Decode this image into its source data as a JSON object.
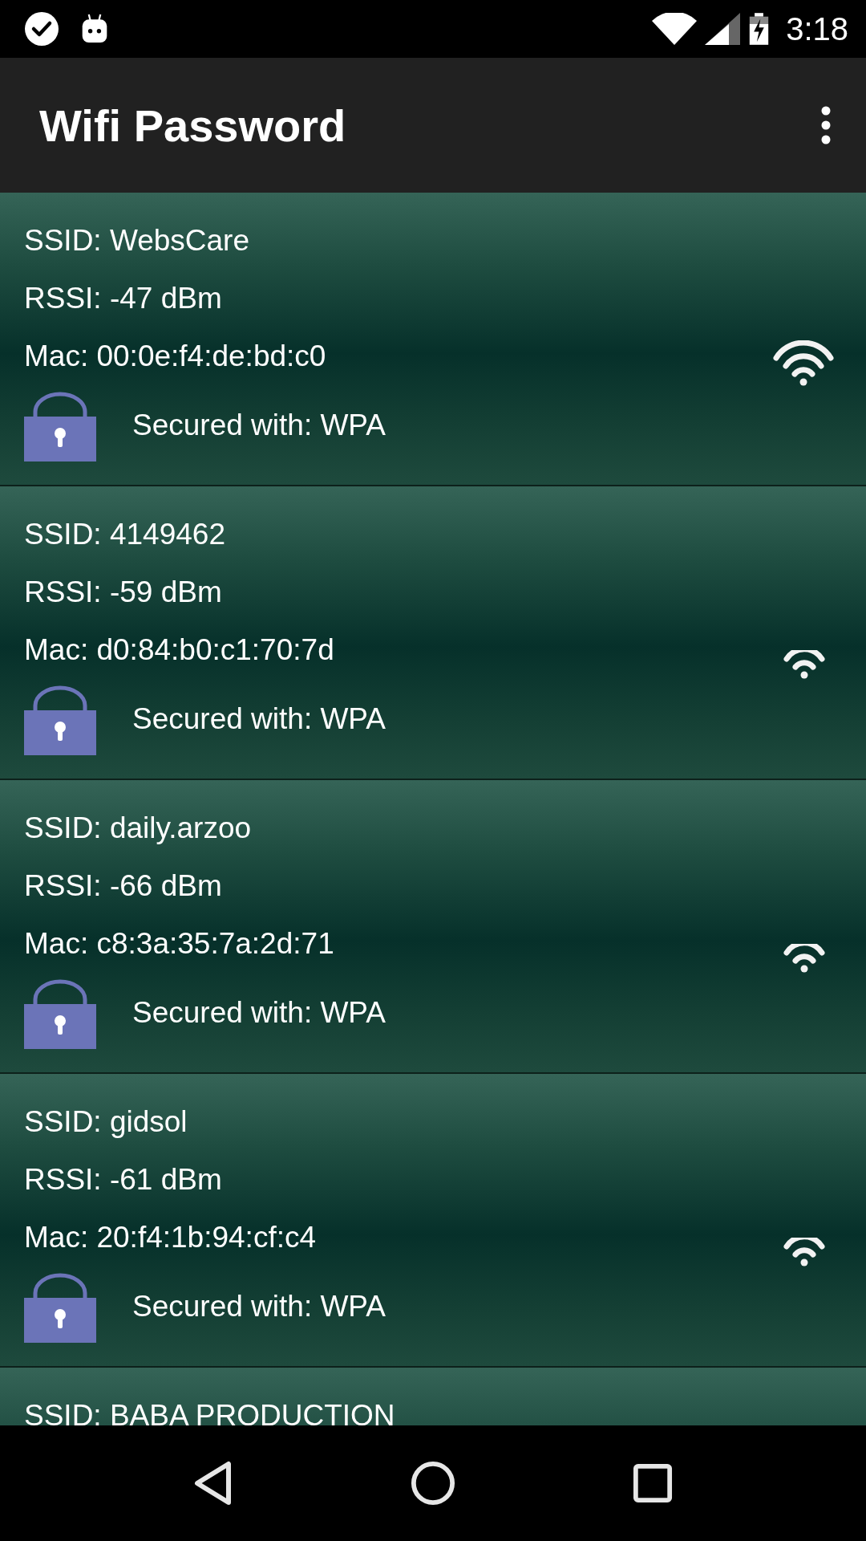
{
  "status_bar": {
    "time": "3:18"
  },
  "app_bar": {
    "title": "Wifi Password"
  },
  "networks": [
    {
      "ssid": "SSID: WebsCare",
      "rssi": "RSSI: -47 dBm",
      "mac": "Mac: 00:0e:f4:de:bd:c0",
      "security": "Secured with: WPA",
      "kind": "strong"
    },
    {
      "ssid": "SSID: 4149462",
      "rssi": "RSSI: -59 dBm",
      "mac": "Mac: d0:84:b0:c1:70:7d",
      "security": "Secured with: WPA",
      "kind": "fair"
    },
    {
      "ssid": "SSID: daily.arzoo",
      "rssi": "RSSI: -66 dBm",
      "mac": "Mac: c8:3a:35:7a:2d:71",
      "security": "Secured with: WPA",
      "kind": "fair"
    },
    {
      "ssid": "SSID: gidsol",
      "rssi": "RSSI: -61 dBm",
      "mac": "Mac: 20:f4:1b:94:cf:c4",
      "security": "Secured with: WPA",
      "kind": "fair"
    },
    {
      "ssid": "SSID: BABA PRODUCTION"
    }
  ]
}
